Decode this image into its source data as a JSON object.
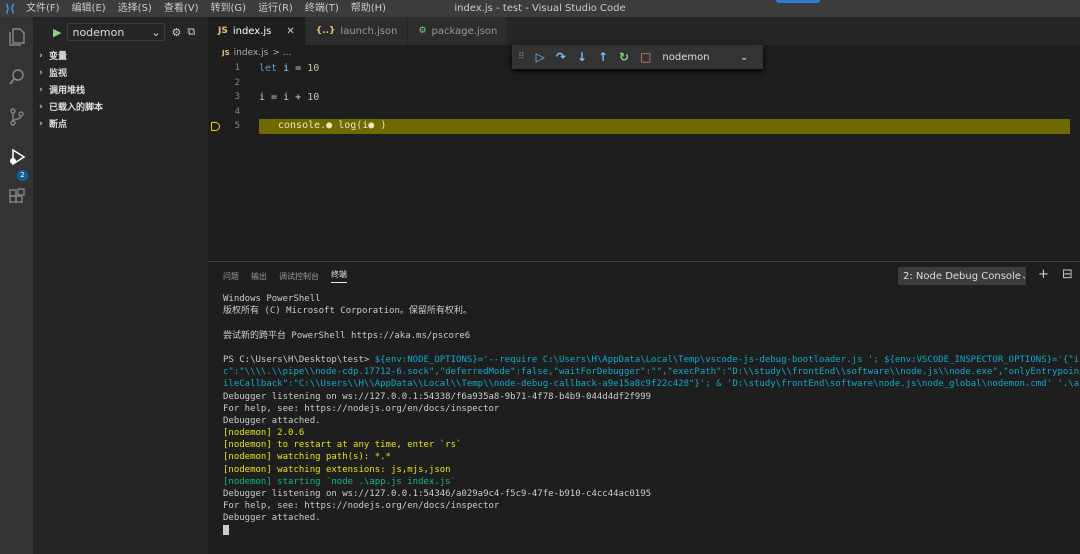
{
  "window": {
    "title": "index.js - test - Visual Studio Code",
    "menus": [
      "文件(F)",
      "编辑(E)",
      "选择(S)",
      "查看(V)",
      "转到(G)",
      "运行(R)",
      "终端(T)",
      "帮助(H)"
    ]
  },
  "activity": {
    "badge": "2"
  },
  "sidebar": {
    "config": "nodemon",
    "sections": [
      "变量",
      "监视",
      "调用堆栈",
      "已载入的脚本",
      "断点"
    ]
  },
  "tabs": [
    {
      "icon": "JS",
      "label": "index.js",
      "close": "✕"
    },
    {
      "icon": "{..}",
      "label": "launch.json"
    },
    {
      "icon": "⚙",
      "label": "package.json"
    }
  ],
  "breadcrumb": {
    "file": "index.js",
    "rest": "> ..."
  },
  "editor": {
    "lines": [
      {
        "n": "1",
        "code": "let i = 10"
      },
      {
        "n": "2",
        "code": ""
      },
      {
        "n": "3",
        "code": "i = i + 10"
      },
      {
        "n": "4",
        "code": ""
      },
      {
        "n": "5",
        "code": "console.● log(i● )"
      }
    ]
  },
  "debug_toolbar": {
    "config": "nodemon"
  },
  "panel": {
    "tabs": [
      "问题",
      "输出",
      "调试控制台",
      "终端"
    ],
    "terminal_select": "2: Node Debug Console",
    "add": "+",
    "split": "⊟"
  },
  "terminal": {
    "lines": [
      {
        "t": "Windows PowerShell",
        "c": ""
      },
      {
        "t": "版权所有 (C) Microsoft Corporation。保留所有权利。",
        "c": ""
      },
      {
        "t": "",
        "c": ""
      },
      {
        "t": "尝试新的跨平台 PowerShell https://aka.ms/pscore6",
        "c": ""
      },
      {
        "t": "",
        "c": ""
      },
      {
        "t": "PS C:\\Users\\H\\Desktop\\test> ",
        "c": "",
        "tail": "${env:NODE_OPTIONS}='--require C:\\Users\\H\\AppData\\Local\\Temp\\vscode-js-debug-bootloader.js '; ${env:VSCODE_INSPECTOR_OPTIONS}='{\"i",
        "tc": "c"
      },
      {
        "t": "c\":\"\\\\\\\\.\\\\pipe\\\\node-cdp.17712-6.sock\",\"deferredMode\":false,\"waitForDebugger\":\"\",\"execPath\":\"D:\\\\study\\\\frontEnd\\\\software\\\\node.js\\\\node.exe\",\"onlyEntrypoin",
        "c": "c"
      },
      {
        "t": "ileCallback\":\"C:\\\\Users\\\\H\\\\AppData\\\\Local\\\\Temp\\\\node-debug-callback-a9e15a8c9f22c428\"}'; & 'D:\\study\\frontEnd\\software\\node.js\\node_global\\nodemon.cmd' '.\\a",
        "c": "c"
      },
      {
        "t": "Debugger listening on ws://127.0.0.1:54338/f6a935a8-9b71-4f78-b4b9-044d4df2f999",
        "c": ""
      },
      {
        "t": "For help, see: https://nodejs.org/en/docs/inspector",
        "c": ""
      },
      {
        "t": "Debugger attached.",
        "c": ""
      },
      {
        "t": "[nodemon] 2.0.6",
        "c": "y"
      },
      {
        "t": "[nodemon] to restart at any time, enter `rs`",
        "c": "y"
      },
      {
        "t": "[nodemon] watching path(s): *.*",
        "c": "y"
      },
      {
        "t": "[nodemon] watching extensions: js,mjs,json",
        "c": "y"
      },
      {
        "t": "[nodemon] starting `node .\\app.js index.js`",
        "c": "g"
      },
      {
        "t": "Debugger listening on ws://127.0.0.1:54346/a029a9c4-f5c9-47fe-b910-c4cc44ac0195",
        "c": ""
      },
      {
        "t": "For help, see: https://nodejs.org/en/docs/inspector",
        "c": ""
      },
      {
        "t": "Debugger attached.",
        "c": ""
      }
    ]
  }
}
